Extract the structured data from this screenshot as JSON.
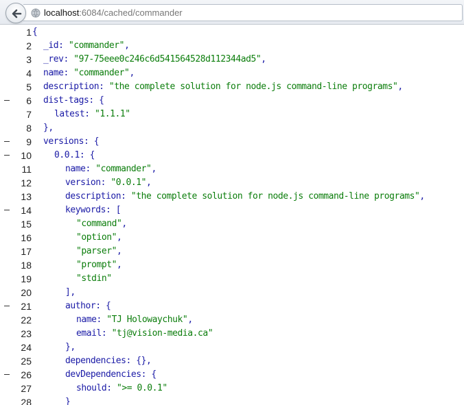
{
  "browser": {
    "url_host": "localhost",
    "url_path": ":6084/cached/commander"
  },
  "lines": [
    {
      "n": "1",
      "fold": false,
      "indent": 0,
      "parts": [
        [
          "p",
          "{"
        ]
      ]
    },
    {
      "n": "2",
      "fold": false,
      "indent": 1,
      "parts": [
        [
          "k",
          "_id"
        ],
        [
          "p",
          ": "
        ],
        [
          "s",
          "\"commander\""
        ],
        [
          "p",
          ","
        ]
      ]
    },
    {
      "n": "3",
      "fold": false,
      "indent": 1,
      "parts": [
        [
          "k",
          "_rev"
        ],
        [
          "p",
          ": "
        ],
        [
          "s",
          "\"97-75eee0c246c6d541564528d112344ad5\""
        ],
        [
          "p",
          ","
        ]
      ]
    },
    {
      "n": "4",
      "fold": false,
      "indent": 1,
      "parts": [
        [
          "k",
          "name"
        ],
        [
          "p",
          ": "
        ],
        [
          "s",
          "\"commander\""
        ],
        [
          "p",
          ","
        ]
      ]
    },
    {
      "n": "5",
      "fold": false,
      "indent": 1,
      "parts": [
        [
          "k",
          "description"
        ],
        [
          "p",
          ": "
        ],
        [
          "s",
          "\"the complete solution for node.js command-line programs\""
        ],
        [
          "p",
          ","
        ]
      ]
    },
    {
      "n": "6",
      "fold": true,
      "indent": 1,
      "parts": [
        [
          "k",
          "dist-tags"
        ],
        [
          "p",
          ": {"
        ]
      ]
    },
    {
      "n": "7",
      "fold": false,
      "indent": 2,
      "parts": [
        [
          "k",
          "latest"
        ],
        [
          "p",
          ": "
        ],
        [
          "s",
          "\"1.1.1\""
        ]
      ]
    },
    {
      "n": "8",
      "fold": false,
      "indent": 1,
      "parts": [
        [
          "p",
          "},"
        ]
      ]
    },
    {
      "n": "9",
      "fold": true,
      "indent": 1,
      "parts": [
        [
          "k",
          "versions"
        ],
        [
          "p",
          ": {"
        ]
      ]
    },
    {
      "n": "10",
      "fold": true,
      "indent": 2,
      "parts": [
        [
          "k",
          "0.0.1"
        ],
        [
          "p",
          ": {"
        ]
      ]
    },
    {
      "n": "11",
      "fold": false,
      "indent": 3,
      "parts": [
        [
          "k",
          "name"
        ],
        [
          "p",
          ": "
        ],
        [
          "s",
          "\"commander\""
        ],
        [
          "p",
          ","
        ]
      ]
    },
    {
      "n": "12",
      "fold": false,
      "indent": 3,
      "parts": [
        [
          "k",
          "version"
        ],
        [
          "p",
          ": "
        ],
        [
          "s",
          "\"0.0.1\""
        ],
        [
          "p",
          ","
        ]
      ]
    },
    {
      "n": "13",
      "fold": false,
      "indent": 3,
      "parts": [
        [
          "k",
          "description"
        ],
        [
          "p",
          ": "
        ],
        [
          "s",
          "\"the complete solution for node.js command-line programs\""
        ],
        [
          "p",
          ","
        ]
      ]
    },
    {
      "n": "14",
      "fold": true,
      "indent": 3,
      "parts": [
        [
          "k",
          "keywords"
        ],
        [
          "p",
          ": ["
        ]
      ]
    },
    {
      "n": "15",
      "fold": false,
      "indent": 4,
      "parts": [
        [
          "s",
          "\"command\""
        ],
        [
          "p",
          ","
        ]
      ]
    },
    {
      "n": "16",
      "fold": false,
      "indent": 4,
      "parts": [
        [
          "s",
          "\"option\""
        ],
        [
          "p",
          ","
        ]
      ]
    },
    {
      "n": "17",
      "fold": false,
      "indent": 4,
      "parts": [
        [
          "s",
          "\"parser\""
        ],
        [
          "p",
          ","
        ]
      ]
    },
    {
      "n": "18",
      "fold": false,
      "indent": 4,
      "parts": [
        [
          "s",
          "\"prompt\""
        ],
        [
          "p",
          ","
        ]
      ]
    },
    {
      "n": "19",
      "fold": false,
      "indent": 4,
      "parts": [
        [
          "s",
          "\"stdin\""
        ]
      ]
    },
    {
      "n": "20",
      "fold": false,
      "indent": 3,
      "parts": [
        [
          "p",
          "],"
        ]
      ]
    },
    {
      "n": "21",
      "fold": true,
      "indent": 3,
      "parts": [
        [
          "k",
          "author"
        ],
        [
          "p",
          ": {"
        ]
      ]
    },
    {
      "n": "22",
      "fold": false,
      "indent": 4,
      "parts": [
        [
          "k",
          "name"
        ],
        [
          "p",
          ": "
        ],
        [
          "s",
          "\"TJ Holowaychuk\""
        ],
        [
          "p",
          ","
        ]
      ]
    },
    {
      "n": "23",
      "fold": false,
      "indent": 4,
      "parts": [
        [
          "k",
          "email"
        ],
        [
          "p",
          ": "
        ],
        [
          "s",
          "\"tj@vision-media.ca\""
        ]
      ]
    },
    {
      "n": "24",
      "fold": false,
      "indent": 3,
      "parts": [
        [
          "p",
          "},"
        ]
      ]
    },
    {
      "n": "25",
      "fold": false,
      "indent": 3,
      "parts": [
        [
          "k",
          "dependencies"
        ],
        [
          "p",
          ": {},"
        ]
      ]
    },
    {
      "n": "26",
      "fold": true,
      "indent": 3,
      "parts": [
        [
          "k",
          "devDependencies"
        ],
        [
          "p",
          ": {"
        ]
      ]
    },
    {
      "n": "27",
      "fold": false,
      "indent": 4,
      "parts": [
        [
          "k",
          "should"
        ],
        [
          "p",
          ": "
        ],
        [
          "s",
          "\">= 0.0.1\""
        ]
      ]
    },
    {
      "n": "28",
      "fold": false,
      "indent": 3,
      "parts": [
        [
          "p",
          "}"
        ]
      ]
    }
  ]
}
